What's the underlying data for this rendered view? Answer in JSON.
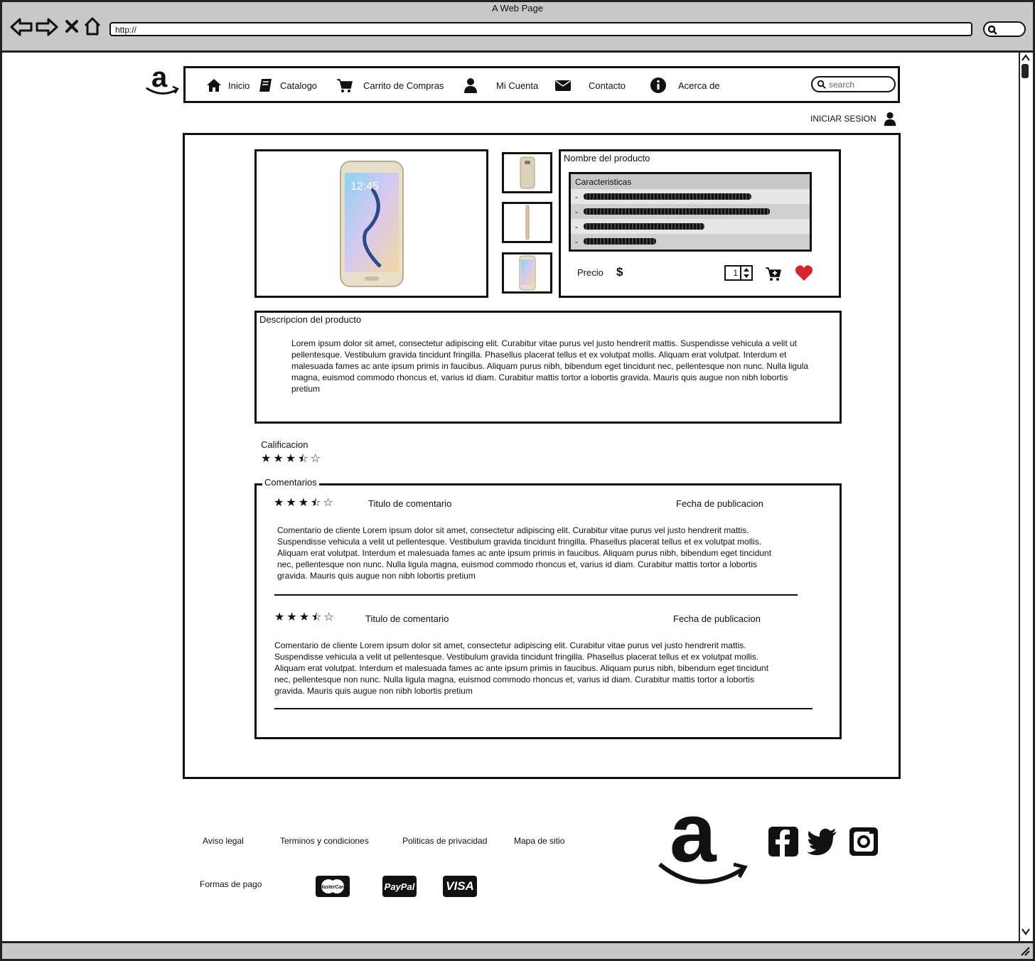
{
  "browser": {
    "title": "A Web Page",
    "url": "http://"
  },
  "nav": {
    "items": [
      {
        "label": "Inicio",
        "icon": "home-icon"
      },
      {
        "label": "Catalogo",
        "icon": "book-icon"
      },
      {
        "label": "Carrito de Compras",
        "icon": "cart-icon"
      },
      {
        "label": "Mi Cuenta",
        "icon": "user-icon"
      },
      {
        "label": "Contacto",
        "icon": "envelope-icon"
      },
      {
        "label": "Acerca de",
        "icon": "info-icon"
      }
    ],
    "search_placeholder": "search",
    "login_label": "INICIAR SESION"
  },
  "product": {
    "name_label": "Nombre del producto",
    "features_label": "Caracteristicas",
    "price_label": "Precio",
    "currency": "$",
    "quantity": "1",
    "description_label": "Descripcion del producto",
    "description": "Lorem ipsum dolor sit amet, consectetur adipiscing elit. Curabitur vitae purus vel justo hendrerit mattis. Suspendisse vehicula a velit ut pellentesque. Vestibulum gravida tincidunt fringilla. Phasellus placerat tellus et ex volutpat mollis. Aliquam erat volutpat. Interdum et malesuada fames ac ante ipsum primis in faucibus. Aliquam purus nibh, bibendum eget tincidunt nec, pellentesque non nunc. Nulla ligula magna, euismod commodo rhoncus et, varius id diam. Curabitur mattis tortor a lobortis gravida. Mauris quis augue non nibh lobortis pretium",
    "phone_time": "12:45"
  },
  "rating": {
    "label": "Calificacion",
    "stars": 3.5,
    "max": 5
  },
  "comments": {
    "label": "Comentarios",
    "items": [
      {
        "title": "Titulo de comentario",
        "date": "Fecha de publicacion",
        "stars": 3.5,
        "text": "Comentario de cliente Lorem ipsum dolor sit amet, consectetur adipiscing elit. Curabitur vitae purus vel justo hendrerit mattis. Suspendisse vehicula a velit ut pellentesque. Vestibulum gravida tincidunt fringilla. Phasellus placerat tellus et ex volutpat mollis. Aliquam erat volutpat. Interdum et malesuada fames ac ante ipsum primis in faucibus. Aliquam purus nibh, bibendum eget tincidunt nec, pellentesque non nunc. Nulla ligula magna, euismod commodo rhoncus et, varius id diam. Curabitur mattis tortor a lobortis gravida. Mauris quis augue non nibh lobortis pretium"
      },
      {
        "title": "Titulo de comentario",
        "date": "Fecha de publicacion",
        "stars": 3.5,
        "text": "Comentario de cliente Lorem ipsum dolor sit amet, consectetur adipiscing elit. Curabitur vitae purus vel justo hendrerit mattis. Suspendisse vehicula a velit ut pellentesque. Vestibulum gravida tincidunt fringilla. Phasellus placerat tellus et ex volutpat mollis. Aliquam erat volutpat. Interdum et malesuada fames ac ante ipsum primis in faucibus. Aliquam purus nibh, bibendum eget tincidunt nec, pellentesque non nunc. Nulla ligula magna, euismod commodo rhoncus et, varius id diam. Curabitur mattis tortor a lobortis gravida. Mauris quis augue non nibh lobortis pretium"
      }
    ]
  },
  "footer": {
    "links": [
      "Aviso legal",
      "Terminos y condiciones",
      "Politicas de privacidad",
      "Mapa de sitio"
    ],
    "payment_label": "Formas de pago",
    "payment_methods": [
      "MasterCard",
      "PayPal",
      "VISA"
    ],
    "social": [
      "facebook-icon",
      "twitter-icon",
      "instagram-icon"
    ]
  }
}
